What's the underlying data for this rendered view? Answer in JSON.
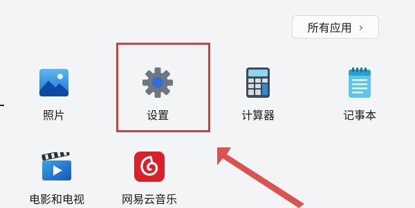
{
  "all_apps_button": {
    "label": "所有应用",
    "chevron": "›"
  },
  "apps": [
    {
      "id": "photos",
      "label": "照片",
      "icon": "photos-icon"
    },
    {
      "id": "settings",
      "label": "设置",
      "icon": "gear-icon"
    },
    {
      "id": "calculator",
      "label": "计算器",
      "icon": "calculator-icon"
    },
    {
      "id": "notepad",
      "label": "记事本",
      "icon": "notepad-icon"
    },
    {
      "id": "movies",
      "label": "电影和电视",
      "icon": "movies-tv-icon"
    },
    {
      "id": "netease",
      "label": "网易云音乐",
      "icon": "netease-music-icon"
    }
  ],
  "colors": {
    "highlight": "#c8413f",
    "arrow": "#d9534f",
    "accent": "#0078d4"
  }
}
